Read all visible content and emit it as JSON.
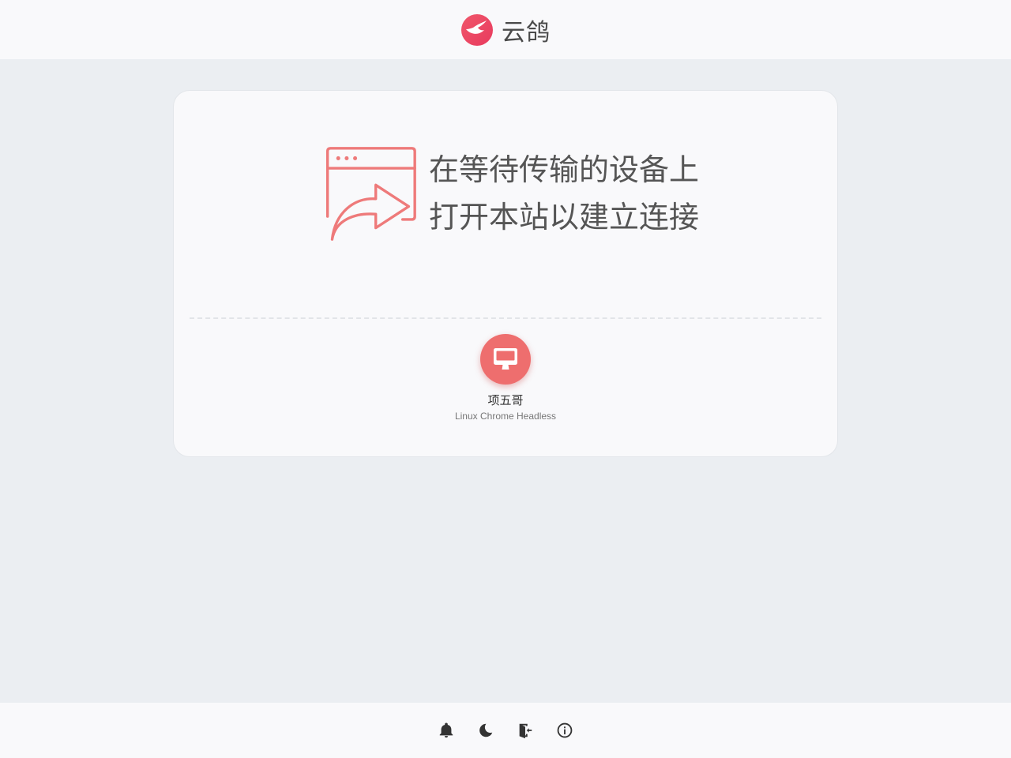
{
  "header": {
    "brand_name": "云鸽",
    "logo_icon": "pigeon-logo-icon"
  },
  "card": {
    "hint_icon": "browser-share-icon",
    "hint_lines": [
      "在等待传输的设备上",
      "打开本站以建立连接"
    ],
    "device": {
      "icon": "desktop-monitor-icon",
      "name": "项五哥",
      "meta": "Linux Chrome Headless"
    }
  },
  "footer": {
    "buttons": [
      {
        "icon": "bell-icon"
      },
      {
        "icon": "moon-icon"
      },
      {
        "icon": "exit-door-icon"
      },
      {
        "icon": "info-icon"
      }
    ]
  },
  "colors": {
    "accent": "#ee6e6e",
    "header_bg": "#f9f9fb",
    "page_bg": "#ebeef2",
    "text": "#555555"
  }
}
